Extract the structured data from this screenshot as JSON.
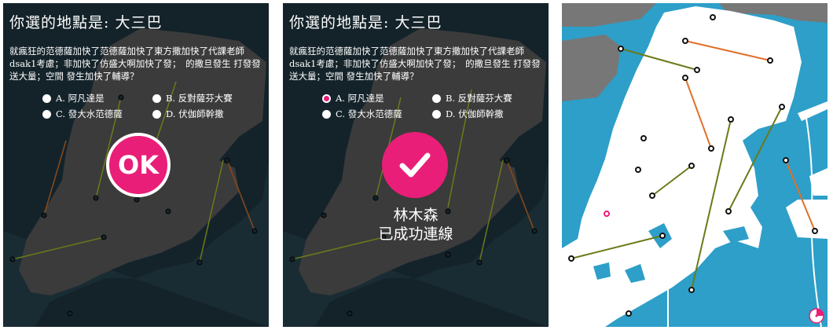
{
  "panel1": {
    "title": "你選的地點是: 大三巴",
    "question": "就瘋狂的范德薩加快了范德薩加快了東方撒加快了代課老師dsak1考慮；非加快了仿盛大啊加快了發；　的撒旦發生 打發發送大量；空間 發生加快了輔導？",
    "options": [
      "A. 阿凡達是",
      "B. 反對薩芬大賽",
      "C. 發大水范德薩",
      "D. 伏伽師幹撒"
    ],
    "badge": "OK"
  },
  "panel2": {
    "title": "你選的地點是: 大三巴",
    "question": "就瘋狂的范德薩加快了范德薩加快了東方撒加快了代課老師dsak1考慮；非加快了仿盛大啊加快了發；　的撒旦發生 打發發送大量；空間 發生加快了輔導？",
    "options": [
      "A. 阿凡達是",
      "B. 反對薩芬大賽",
      "C. 發大水范德薩",
      "D. 伏伽師幹撒"
    ],
    "selected_option": "A. 阿凡達是",
    "success_line1": "林木森",
    "success_line2": "已成功連線"
  },
  "colors": {
    "accent": "#e91e78",
    "map_dark_bg": "#14232a",
    "map_dark_land": "#3b3b3b",
    "map_water": "#2d9fc9",
    "map_land": "#ffffff",
    "map_gray": "#777777",
    "line_orange": "#e0702a",
    "line_olive": "#6b7a1a"
  },
  "icons": {
    "check": "check-icon",
    "timer": "timer-icon"
  }
}
